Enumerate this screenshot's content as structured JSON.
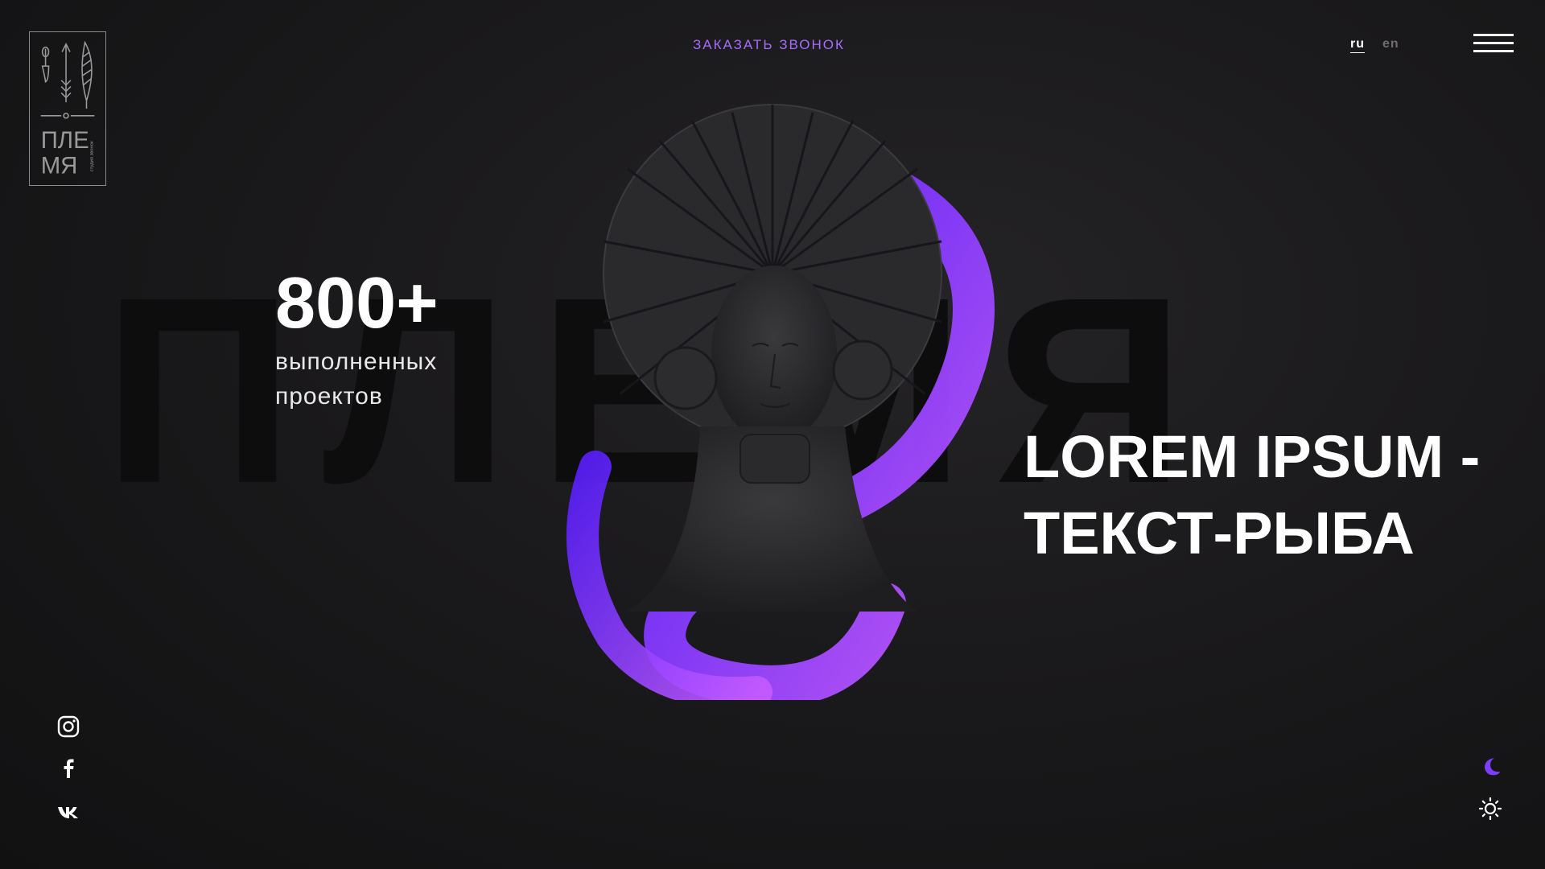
{
  "brand": {
    "logo_line1": "ПЛЕ",
    "logo_line2": "МЯ",
    "logo_tagline": "студия\nзвонок"
  },
  "header": {
    "callback_label": "ЗАКАЗАТЬ ЗВОНОК",
    "lang_ru": "ru",
    "lang_en": "en",
    "menu_icon": "hamburger-icon"
  },
  "background_word": "ПЛЕМЯ",
  "stats": {
    "number": "800+",
    "label": "выполненных проектов"
  },
  "hero": {
    "headline": "LOREM IPSUM - ТЕКСТ-РЫБА"
  },
  "social": [
    "instagram-icon",
    "facebook-icon",
    "vk-icon"
  ],
  "theme_toggle": {
    "dark_icon": "moon-icon",
    "light_icon": "sun-icon"
  },
  "colors": {
    "accent": "#8a4dff",
    "background": "#1a191b",
    "text": "#ffffff"
  }
}
